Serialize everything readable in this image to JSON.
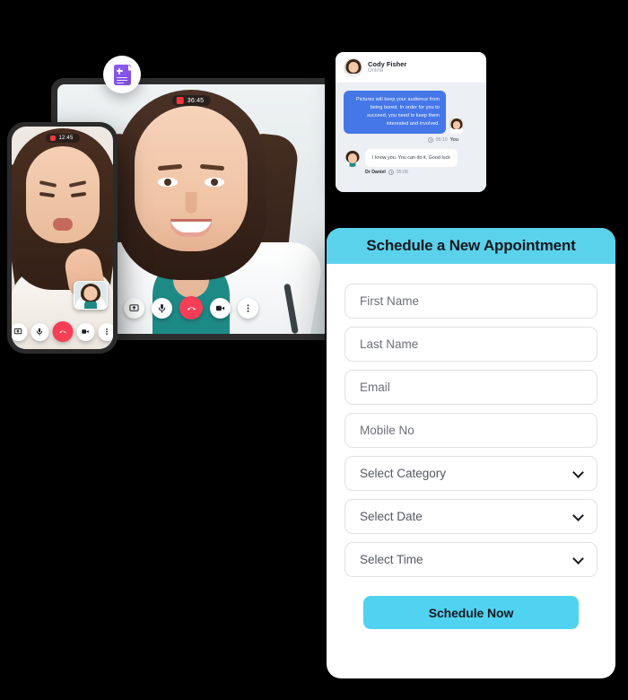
{
  "badge": {
    "icon": "medical-document-icon"
  },
  "video_call": {
    "recording_label": "36:45",
    "recording_icon": "record-dot-icon",
    "controls": [
      {
        "name": "screen-share",
        "label": "screen-share-icon"
      },
      {
        "name": "microphone",
        "label": "microphone-icon"
      },
      {
        "name": "end-call",
        "label": "end-call-icon"
      },
      {
        "name": "camera",
        "label": "video-camera-icon"
      },
      {
        "name": "more-options",
        "label": "more-options-icon"
      }
    ]
  },
  "phone_call": {
    "recording_label": "12:45",
    "controls": [
      {
        "name": "screen-share",
        "label": "screen-share-icon"
      },
      {
        "name": "microphone",
        "label": "microphone-icon"
      },
      {
        "name": "end-call",
        "label": "end-call-icon"
      },
      {
        "name": "camera",
        "label": "video-camera-icon"
      },
      {
        "name": "more-options",
        "label": "more-options-icon"
      }
    ]
  },
  "chat": {
    "contact_name": "Cody Fisher",
    "contact_status": "Online",
    "messages": [
      {
        "text": "Pictures will keep your audience from being bored. In order for you to succeed, you need to keep them interested and involved.",
        "time": "05:10",
        "sender": "You",
        "direction": "outgoing"
      },
      {
        "text": "I know you. You can do it, Good luck",
        "time": "05:08",
        "sender": "Dr Daniel",
        "direction": "incoming"
      }
    ]
  },
  "form": {
    "title": "Schedule a New Appointment",
    "fields": [
      {
        "name": "first-name",
        "placeholder": "First Name",
        "type": "text"
      },
      {
        "name": "last-name",
        "placeholder": "Last Name",
        "type": "text"
      },
      {
        "name": "email",
        "placeholder": "Email",
        "type": "text"
      },
      {
        "name": "mobile-no",
        "placeholder": "Mobile No",
        "type": "text"
      },
      {
        "name": "category",
        "placeholder": "Select Category",
        "type": "select"
      },
      {
        "name": "date",
        "placeholder": "Select Date",
        "type": "select"
      },
      {
        "name": "time",
        "placeholder": "Select Time",
        "type": "select"
      }
    ],
    "submit_label": "Schedule Now"
  },
  "colors": {
    "header_cyan": "#5BD2EC",
    "button_cyan": "#4FD3F0",
    "chat_bubble_blue": "#4577E8",
    "end_call_red": "#F73E56",
    "online_green": "#21C95C",
    "badge_purple": "#8B5CF6",
    "background": "#000000"
  }
}
